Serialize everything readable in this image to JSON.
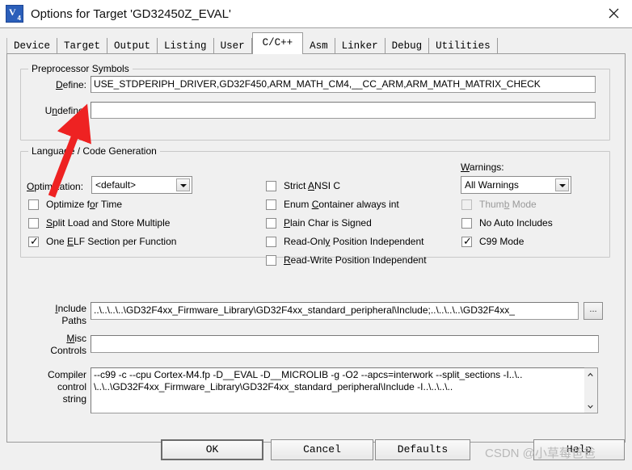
{
  "window": {
    "title": "Options for Target 'GD32450Z_EVAL'",
    "icon": "uvision-logo-icon",
    "close_label": "✕"
  },
  "tabs": [
    {
      "label": "Device",
      "active": false
    },
    {
      "label": "Target",
      "active": false
    },
    {
      "label": "Output",
      "active": false
    },
    {
      "label": "Listing",
      "active": false
    },
    {
      "label": "User",
      "active": false
    },
    {
      "label": "C/C++",
      "active": true
    },
    {
      "label": "Asm",
      "active": false
    },
    {
      "label": "Linker",
      "active": false
    },
    {
      "label": "Debug",
      "active": false
    },
    {
      "label": "Utilities",
      "active": false
    }
  ],
  "preprocessor": {
    "group_title": "Preprocessor Symbols",
    "define_label": "Define:",
    "define_value": "USE_STDPERIPH_DRIVER,GD32F450,ARM_MATH_CM4,__CC_ARM,ARM_MATH_MATRIX_CHECK",
    "undefine_label": "Undefine:",
    "undefine_value": ""
  },
  "language": {
    "group_title": "Language / Code Generation",
    "optimization_label": "Optimization:",
    "optimization_value": "<default>",
    "warnings_label": "Warnings:",
    "warnings_value": "All Warnings",
    "left_checks": [
      {
        "label": "Optimize for Time",
        "checked": false,
        "disabled": false
      },
      {
        "label": "Split Load and Store Multiple",
        "checked": false,
        "disabled": false
      },
      {
        "label": "One ELF Section per Function",
        "checked": true,
        "disabled": false
      }
    ],
    "mid_checks": [
      {
        "label": "Strict ANSI C",
        "checked": false,
        "disabled": false
      },
      {
        "label": "Enum Container always int",
        "checked": false,
        "disabled": false
      },
      {
        "label": "Plain Char is Signed",
        "checked": false,
        "disabled": false
      },
      {
        "label": "Read-Only Position Independent",
        "checked": false,
        "disabled": false
      },
      {
        "label": "Read-Write Position Independent",
        "checked": false,
        "disabled": false
      }
    ],
    "right_checks": [
      {
        "label": "Thumb Mode",
        "checked": false,
        "disabled": true
      },
      {
        "label": "No Auto Includes",
        "checked": false,
        "disabled": false
      },
      {
        "label": "C99 Mode",
        "checked": true,
        "disabled": false
      }
    ]
  },
  "paths": {
    "include_label_1": "Include",
    "include_label_2": "Paths",
    "include_value": "..\\..\\..\\..\\GD32F4xx_Firmware_Library\\GD32F4xx_standard_peripheral\\Include;..\\..\\..\\..\\GD32F4xx_",
    "browse_label": "...",
    "misc_label_1": "Misc",
    "misc_label_2": "Controls",
    "misc_value": "",
    "compiler_label_1": "Compiler",
    "compiler_label_2": "control",
    "compiler_label_3": "string",
    "compiler_value": "--c99 -c --cpu Cortex-M4.fp -D__EVAL -D__MICROLIB -g -O2 --apcs=interwork --split_sections -I..\\..\n\\..\\..\\GD32F4xx_Firmware_Library\\GD32F4xx_standard_peripheral\\Include -I..\\..\\..\\.."
  },
  "buttons": {
    "ok": "OK",
    "cancel": "Cancel",
    "defaults": "Defaults",
    "help": "Help"
  },
  "annotation": {
    "arrow_color": "#ee2222"
  },
  "watermark": {
    "text": "CSDN @小草莓爸爸"
  }
}
